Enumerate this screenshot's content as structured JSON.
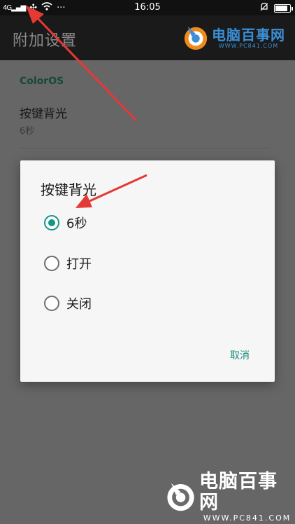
{
  "status_bar": {
    "signal_text": "4G",
    "time": "16:05",
    "icons": [
      "signal-icon",
      "network-icon",
      "wifi-icon",
      "more-icon",
      "alarm-icon",
      "battery-icon"
    ],
    "battery_level": 0.85
  },
  "header": {
    "title": "附加设置"
  },
  "watermark": {
    "brand": "电脑百事网",
    "url": "WWW.PC841.COM"
  },
  "content": {
    "section_label": "ColorOS",
    "preference": {
      "title": "按键背光",
      "summary": "6秒"
    }
  },
  "dialog": {
    "title": "按键背光",
    "options": [
      {
        "label": "6秒",
        "selected": true
      },
      {
        "label": "打开",
        "selected": false
      },
      {
        "label": "关闭",
        "selected": false
      }
    ],
    "cancel_label": "取消"
  },
  "colors": {
    "accent": "#159686",
    "arrow": "#e53935",
    "brand": "#3b8fd6"
  }
}
